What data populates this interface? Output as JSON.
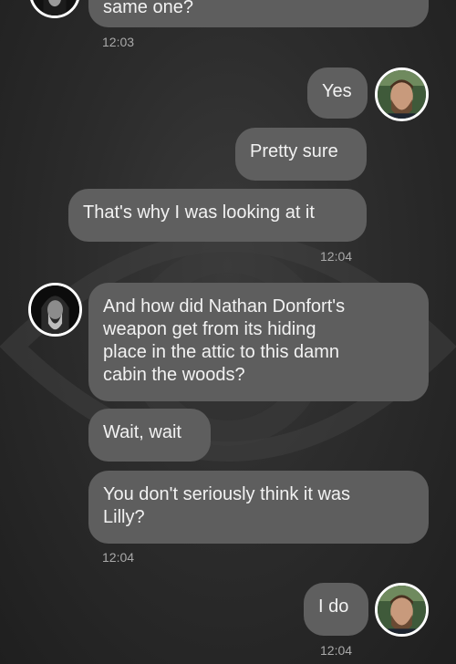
{
  "messages": [
    {
      "side": "in",
      "text": "same one?"
    },
    {
      "side": "in",
      "time": "12:03"
    },
    {
      "side": "out",
      "text": "Yes"
    },
    {
      "side": "out",
      "text": "Pretty sure"
    },
    {
      "side": "out",
      "text": "That's why I was looking at it"
    },
    {
      "side": "out",
      "time": "12:04"
    },
    {
      "side": "in",
      "text": "And how did Nathan Donfort's\nweapon get from its hiding\nplace in the attic to this damn\ncabin the woods?"
    },
    {
      "side": "in",
      "text": "Wait, wait"
    },
    {
      "side": "in",
      "text": "You don't seriously think it was\nLilly?"
    },
    {
      "side": "in",
      "time": "12:04"
    },
    {
      "side": "out",
      "text": "I do"
    },
    {
      "side": "out",
      "time": "12:04"
    }
  ]
}
